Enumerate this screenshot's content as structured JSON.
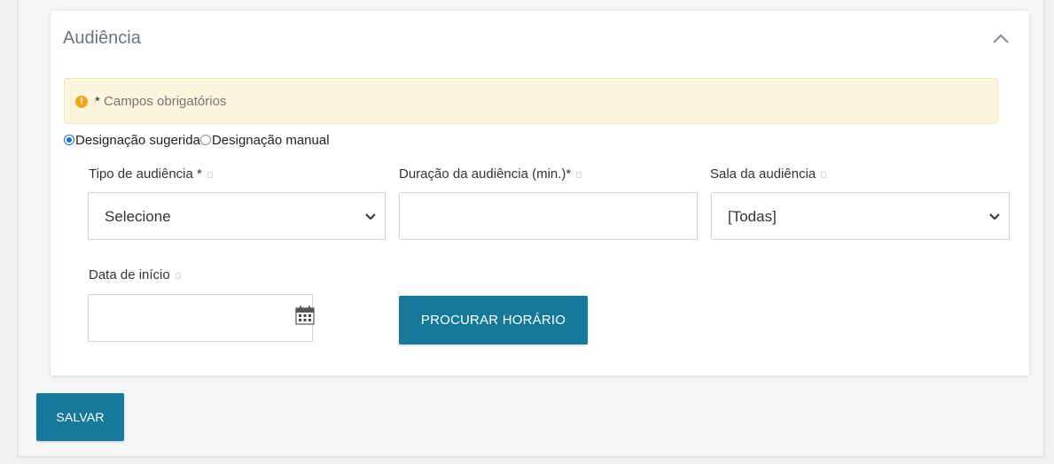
{
  "panel": {
    "title": "Audiência",
    "collapse_icon": "chevron-up-icon"
  },
  "alert": {
    "icon": "info-icon",
    "icon_glyph": "!",
    "star": "*",
    "text": "Campos obrigatórios"
  },
  "designation": {
    "options": [
      {
        "label": "Designação sugerida",
        "checked": true
      },
      {
        "label": "Designação manual",
        "checked": false
      }
    ]
  },
  "fields": {
    "tipo": {
      "label": "Tipo de audiência *",
      "value": "Selecione"
    },
    "duracao": {
      "label": "Duração da audiência (min.)*",
      "value": ""
    },
    "sala": {
      "label": "Sala da audiência",
      "value": "[Todas]"
    },
    "data_inicio": {
      "label": "Data de início",
      "value": ""
    }
  },
  "buttons": {
    "procurar": "PROCURAR HORÁRIO",
    "salvar": "SALVAR"
  },
  "colors": {
    "primary": "#16799a",
    "alert_bg": "#fcf4dd",
    "alert_icon": "#f0a51c",
    "radio_checked": "#1a73c8"
  }
}
